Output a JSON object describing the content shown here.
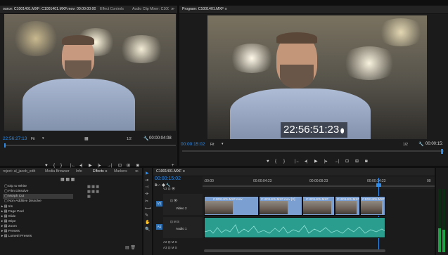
{
  "source_monitor": {
    "tabs": [
      "ource: C1001401.MXF: C1001401.MXF.mov: 00:00:00:00 ≡",
      "Effect Controls",
      "Audio Clip Mixer: C1001",
      "≫"
    ],
    "timecode": "22:56:27:13",
    "fit": "Fit",
    "scale": "1/2",
    "duration": "00:00:04:08"
  },
  "program_monitor": {
    "tab": "Program: C1001401.MXF ≡",
    "timecode_overlay": "22:56:51:23",
    "timecode": "00:00:15:02",
    "fit": "Fit",
    "scale": "1/2",
    "duration": "00:00:15:"
  },
  "project_panel": {
    "tabs": [
      "roject: al_jacob_edit",
      "Media Browser",
      "Info",
      "Effects ≡",
      "Markers",
      "≫"
    ],
    "items": [
      "Dip to White",
      "Film Dissolve",
      "Morph Cut",
      "Non-Additive Dissolve",
      "Iris",
      "Page Peel",
      "Slide",
      "Wipe",
      "Zoom",
      "Presets",
      "Lumetri Presets"
    ]
  },
  "timeline": {
    "tab": "C1001401.MXF ≡",
    "timecode": "00:00:15:02",
    "ruler_labels": [
      ":00:00",
      "00:00:04:23",
      "00:00:09:23",
      "00:00:14:23",
      "00"
    ],
    "tracks": {
      "v2": "Video 2",
      "a1": "Audio 1",
      "v1": "V1",
      "a1_label": "A1"
    },
    "clips": [
      {
        "label": "C1001401.MXF.mov"
      },
      {
        "label": "C1001401.MXF.mov [V]"
      },
      {
        "label": "C1001401.MXF"
      },
      {
        "label": "C1001401.MXF"
      },
      {
        "label": "C1001401.MXF"
      }
    ]
  },
  "colors": {
    "accent": "#2d8ceb",
    "video_clip": "#7b9fd0",
    "audio_clip": "#2a9d8f",
    "panel_bg": "#1b1b1b"
  }
}
